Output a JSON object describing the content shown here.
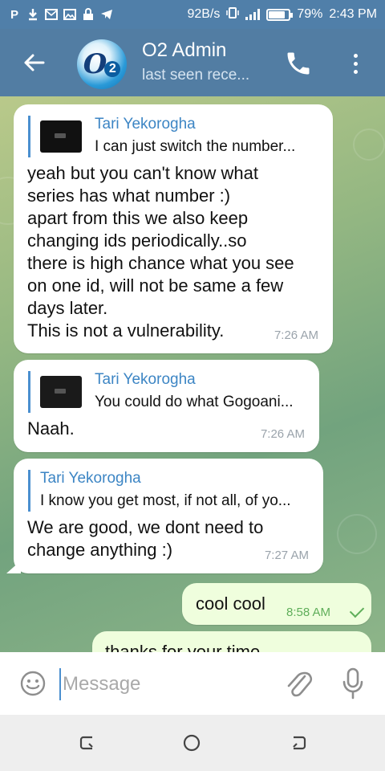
{
  "status_bar": {
    "left_icons": [
      "parking-icon",
      "download-icon",
      "mail-icon",
      "image-icon",
      "lock-icon",
      "telegram-icon"
    ],
    "speed": "92B/s",
    "battery": "79%",
    "time": "2:43 PM"
  },
  "header": {
    "title": "O2 Admin",
    "subtitle": "last seen rece...",
    "avatar_text": "O",
    "avatar_sub": "2"
  },
  "messages": [
    {
      "direction": "in",
      "reply_name": "Tari Yekorogha",
      "reply_text": "I can just switch the number...",
      "text": "yeah but you can't know what\nseries has what number :)\napart from this we also keep\nchanging ids periodically..so\nthere is high chance what you see\non one id, will not be same a few\ndays later.\nThis is not a vulnerability.",
      "time": "7:26 AM"
    },
    {
      "direction": "in",
      "reply_name": "Tari Yekorogha",
      "reply_text": "You could do what Gogoani...",
      "text": "Naah.",
      "time": "7:26 AM"
    },
    {
      "direction": "in",
      "reply_name": "Tari Yekorogha",
      "reply_text": "I know you get most, if not all, of yo...",
      "text": "We are good, we dont need to\nchange anything :)",
      "time": "7:27 AM"
    },
    {
      "direction": "out",
      "text": "cool cool",
      "time": "8:58 AM"
    },
    {
      "direction": "out",
      "text": "thanks for your time"
    }
  ],
  "input": {
    "placeholder": "Message"
  },
  "colors": {
    "header": "#527da3",
    "accent": "#3c85c4",
    "outgoing_bubble": "#effedd"
  }
}
